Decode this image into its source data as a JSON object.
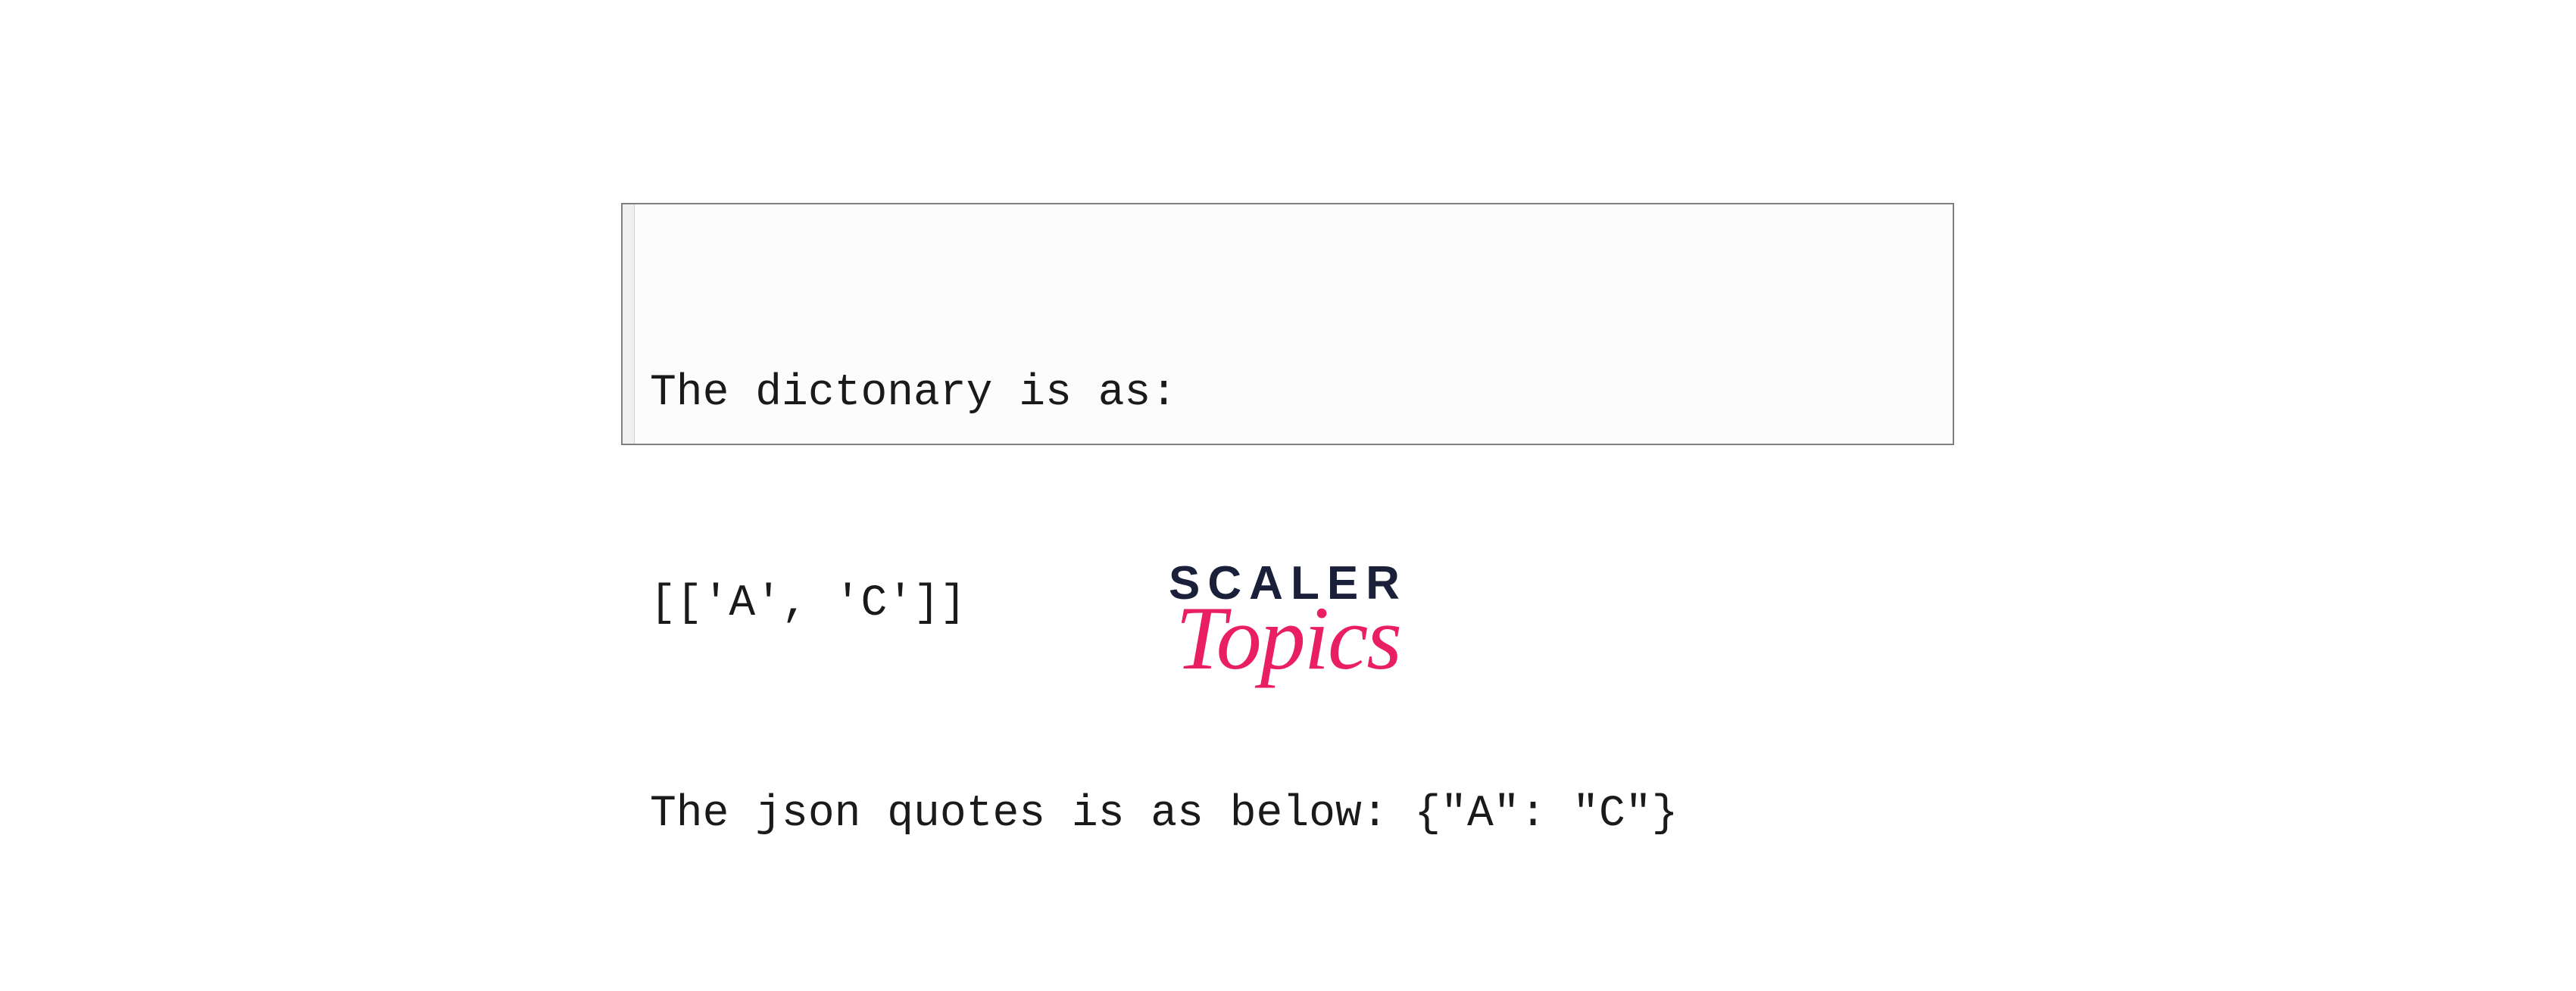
{
  "code": {
    "line1": "The dictonary is as:",
    "line2": "[['A', 'C']]",
    "line3": "The json quotes is as below: {\"A\": \"C\"}"
  },
  "logo": {
    "main": "SCALER",
    "sub": "Topics"
  }
}
